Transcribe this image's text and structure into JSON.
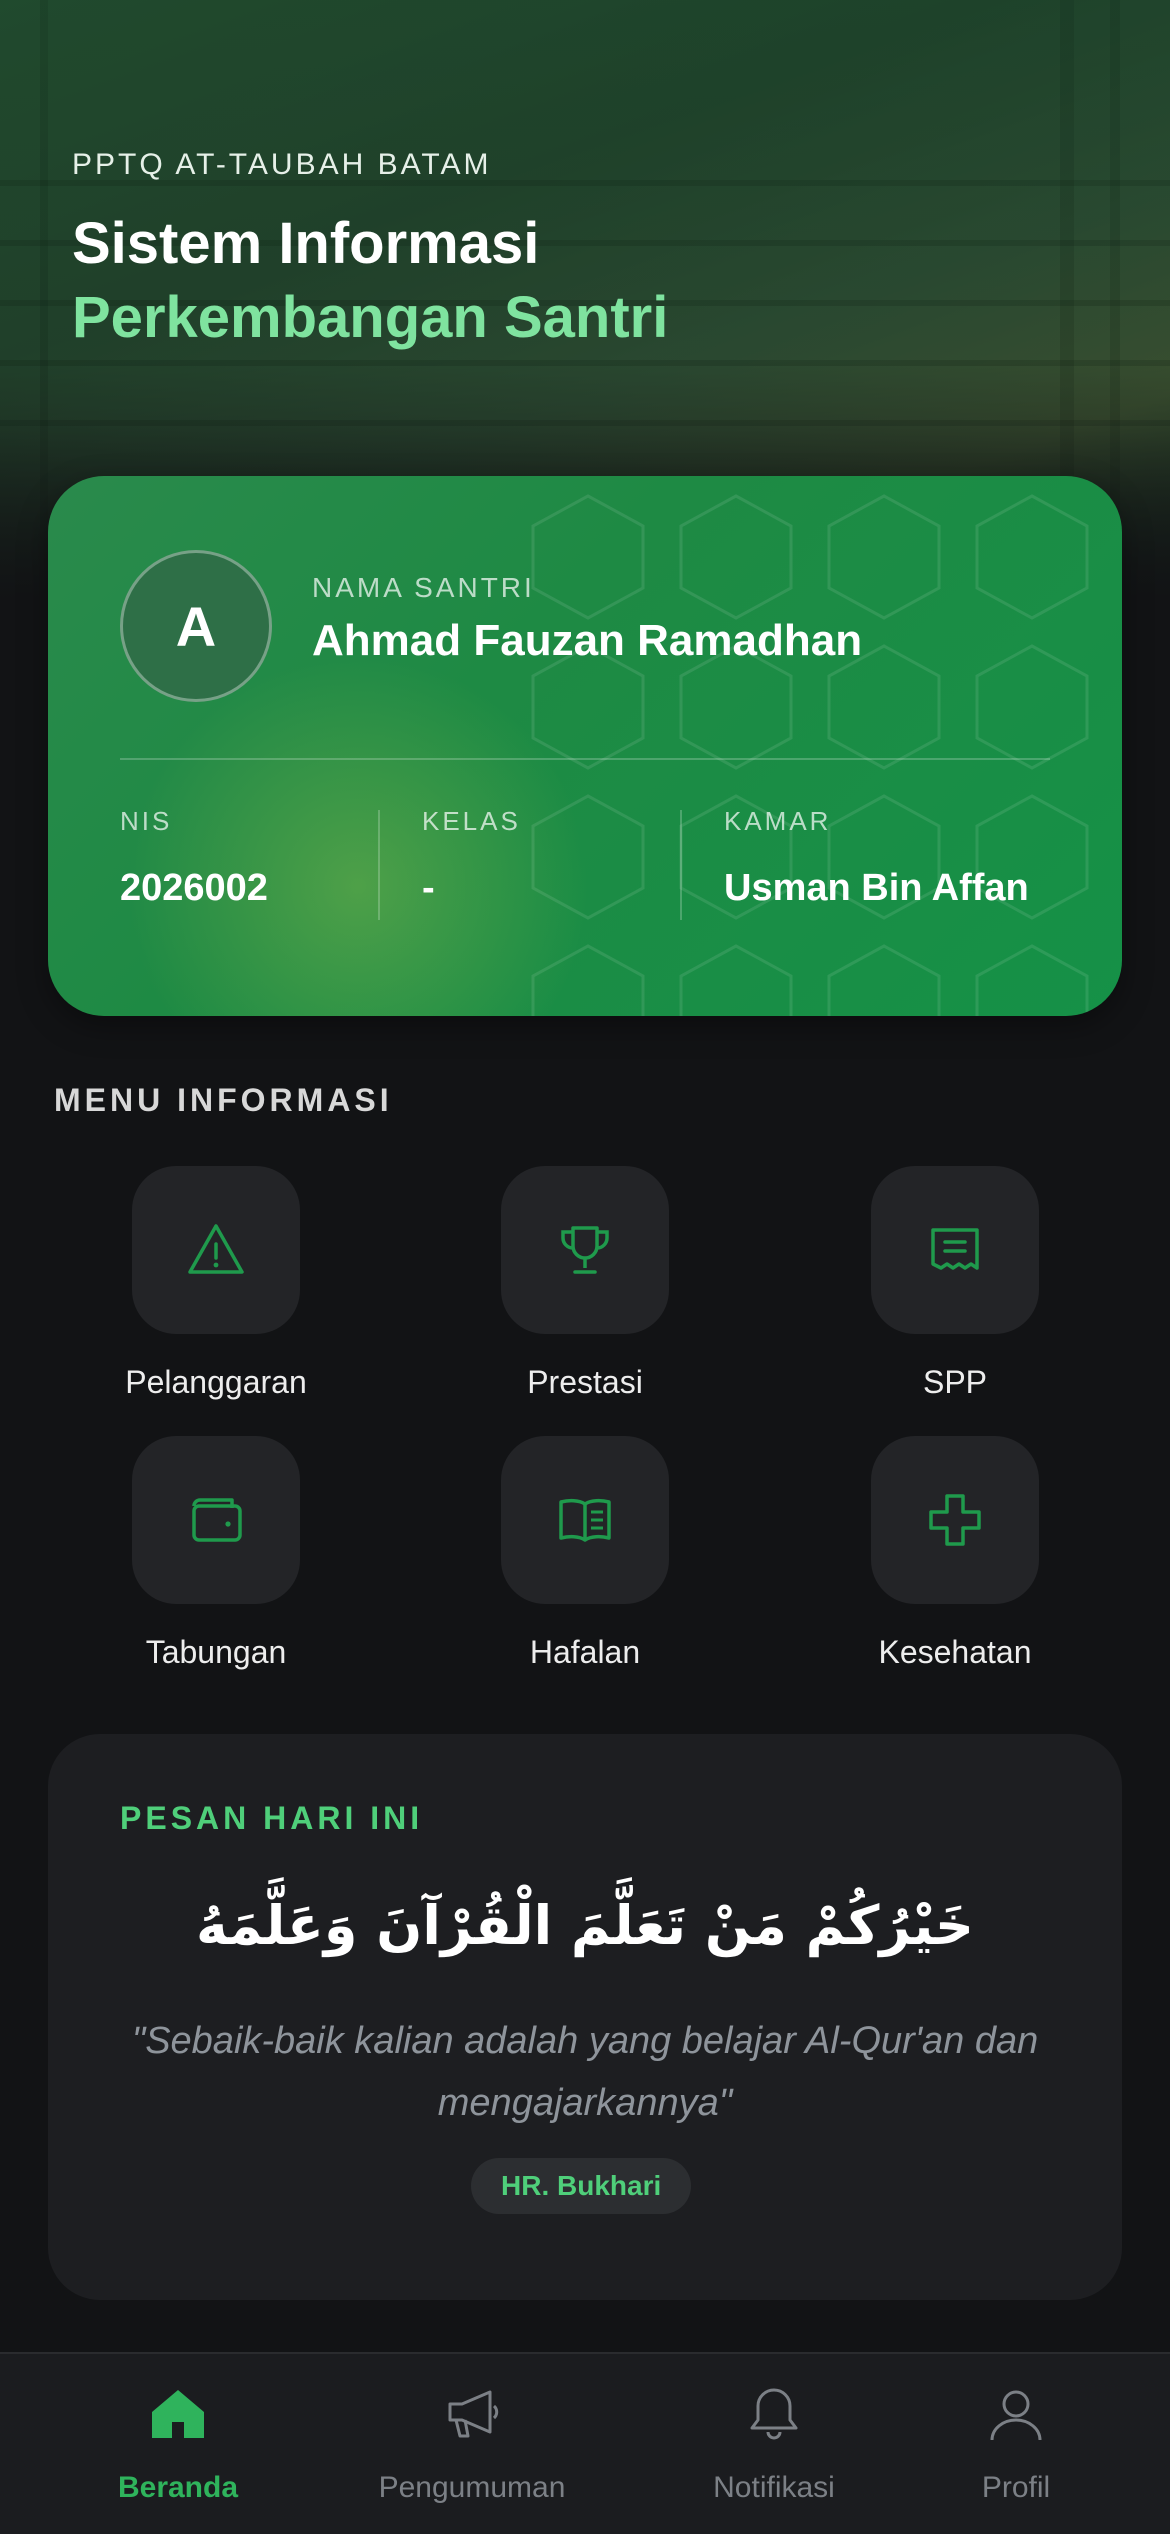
{
  "header": {
    "school_name": "PPTQ AT-TAUBAH BATAM",
    "title_line1": "Sistem Informasi",
    "title_line2": "Perkembangan Santri"
  },
  "student_card": {
    "avatar_initial": "A",
    "name_label": "NAMA SANTRI",
    "name": "Ahmad Fauzan Ramadhan",
    "stats": [
      {
        "label": "NIS",
        "value": "2026002"
      },
      {
        "label": "KELAS",
        "value": "-"
      },
      {
        "label": "KAMAR",
        "value": "Usman Bin Affan"
      }
    ]
  },
  "menu": {
    "title": "MENU INFORMASI",
    "items": [
      {
        "label": "Pelanggaran",
        "icon": "warning-icon"
      },
      {
        "label": "Prestasi",
        "icon": "trophy-icon"
      },
      {
        "label": "SPP",
        "icon": "receipt-icon"
      },
      {
        "label": "Tabungan",
        "icon": "wallet-icon"
      },
      {
        "label": "Hafalan",
        "icon": "book-icon"
      },
      {
        "label": "Kesehatan",
        "icon": "medical-cross-icon"
      }
    ]
  },
  "daily_message": {
    "title": "PESAN HARI INI",
    "arabic": "خَيْرُكُمْ مَنْ تَعَلَّمَ الْقُرْآنَ وَعَلَّمَهُ",
    "translation": "\"Sebaik-baik kalian adalah yang belajar Al-Qur'an dan mengajarkannya\"",
    "source": "HR. Bukhari"
  },
  "bottom_nav": {
    "items": [
      {
        "label": "Beranda",
        "icon": "home-icon",
        "active": true
      },
      {
        "label": "Pengumuman",
        "icon": "megaphone-icon",
        "active": false
      },
      {
        "label": "Notifikasi",
        "icon": "bell-icon",
        "active": false
      },
      {
        "label": "Profil",
        "icon": "user-icon",
        "active": false
      }
    ]
  },
  "colors": {
    "accent": "#2fb35c",
    "accent_light": "#7fe39f",
    "card_green": "#1e8a44",
    "background": "#121315"
  }
}
